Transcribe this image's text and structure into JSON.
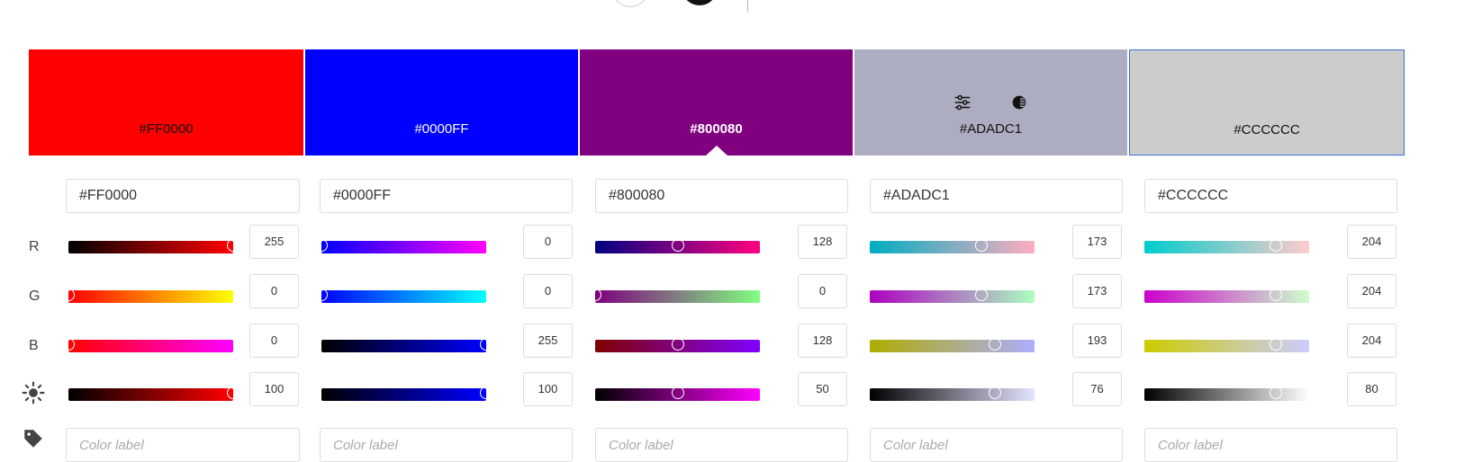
{
  "colors": [
    {
      "hex": "#FF0000",
      "text_color": "#111111",
      "r": 255,
      "g": 0,
      "b": 0,
      "brightness": 100,
      "r_pct": 1.0,
      "g_pct": 0.0,
      "b_pct": 0.0,
      "brightness_pct": 1.0,
      "r_grad": "linear-gradient(to right,#000000,#ff0000)",
      "g_grad": "linear-gradient(to right,#ff0000,#ffff00)",
      "b_grad": "linear-gradient(to right,#ff0000,#ff00ff)",
      "br_grad": "linear-gradient(to right,#000000,#ff0000)",
      "label_placeholder": "Color label"
    },
    {
      "hex": "#0000FF",
      "text_color": "#ffffff",
      "r": 0,
      "g": 0,
      "b": 255,
      "brightness": 100,
      "r_pct": 0.0,
      "g_pct": 0.0,
      "b_pct": 1.0,
      "brightness_pct": 1.0,
      "r_grad": "linear-gradient(to right,#0000ff,#ff00ff)",
      "g_grad": "linear-gradient(to right,#0000ff,#00ffff)",
      "b_grad": "linear-gradient(to right,#000000,#0000ff)",
      "br_grad": "linear-gradient(to right,#000000,#0000ff)",
      "label_placeholder": "Color label"
    },
    {
      "hex": "#800080",
      "text_color": "#ffffff",
      "r": 128,
      "g": 0,
      "b": 128,
      "brightness": 50,
      "r_pct": 0.502,
      "g_pct": 0.0,
      "b_pct": 0.502,
      "brightness_pct": 0.5,
      "r_grad": "linear-gradient(to right,#000080,#ff0080)",
      "g_grad": "linear-gradient(to right,#800080,#80ff80)",
      "b_grad": "linear-gradient(to right,#800000,#8000ff)",
      "br_grad": "linear-gradient(to right,#000000,#ff00ff)",
      "label_placeholder": "Color label"
    },
    {
      "hex": "#ADADC1",
      "text_color": "#111111",
      "r": 173,
      "g": 173,
      "b": 193,
      "brightness": 76,
      "r_pct": 0.678,
      "g_pct": 0.678,
      "b_pct": 0.757,
      "brightness_pct": 0.76,
      "r_grad": "linear-gradient(to right,#00adc1,#ffadc1)",
      "g_grad": "linear-gradient(to right,#ad00c1,#adffc1)",
      "b_grad": "linear-gradient(to right,#adad00,#adadff)",
      "br_grad": "linear-gradient(to right,#000000,#e4e4ff)",
      "label_placeholder": "Color label"
    },
    {
      "hex": "#CCCCCC",
      "text_color": "#111111",
      "r": 204,
      "g": 204,
      "b": 204,
      "brightness": 80,
      "r_pct": 0.8,
      "g_pct": 0.8,
      "b_pct": 0.8,
      "brightness_pct": 0.8,
      "r_grad": "linear-gradient(to right,#00cccc,#ffcccc)",
      "g_grad": "linear-gradient(to right,#cc00cc,#ccffcc)",
      "b_grad": "linear-gradient(to right,#cccc00,#ccccff)",
      "br_grad": "linear-gradient(to right,#000000,#ffffff)",
      "label_placeholder": "Color label"
    }
  ],
  "row_labels": {
    "r": "R",
    "g": "G",
    "b": "B"
  },
  "icons": {
    "brightness": "sun-icon",
    "label": "tag-icon",
    "adjust": "sliders-icon",
    "contrast": "contrast-icon"
  },
  "selected_index": 4,
  "active_caret_index": 2,
  "selection_color": "#3b6fd6"
}
